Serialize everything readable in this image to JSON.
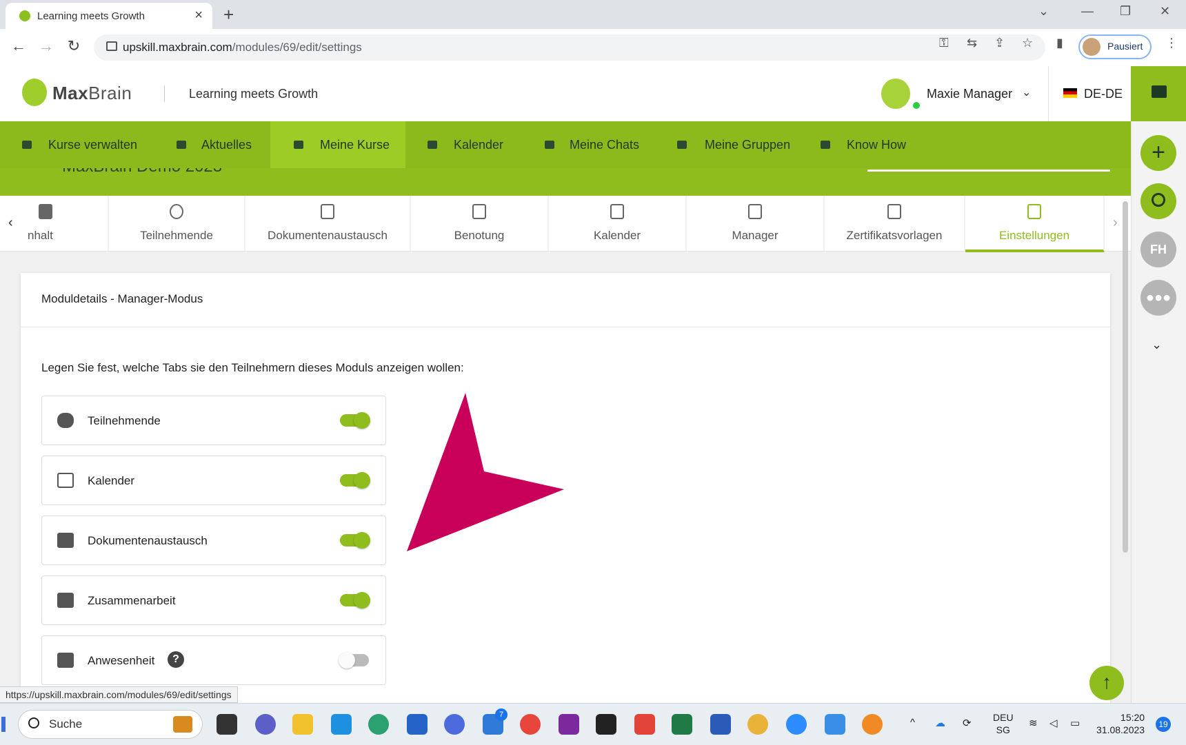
{
  "browser": {
    "tab_title": "Learning meets Growth",
    "new_tab": "+",
    "url_host": "upskill.maxbrain.com",
    "url_path": "/modules/69/edit/settings",
    "profile_status": "Pausiert",
    "status_url": "https://upskill.maxbrain.com/modules/69/edit/settings"
  },
  "header": {
    "logo_bold": "Max",
    "logo_light": "Brain",
    "tagline": "Learning meets Growth",
    "user_name": "Maxie Manager",
    "language": "DE-DE"
  },
  "rail": {
    "add": "+",
    "initials": "FH"
  },
  "nav": {
    "items": [
      {
        "label": "Kurse verwalten"
      },
      {
        "label": "Aktuelles"
      },
      {
        "label": "Meine Kurse"
      },
      {
        "label": "Kalender"
      },
      {
        "label": "Meine Chats"
      },
      {
        "label": "Meine Gruppen"
      },
      {
        "label": "Know How"
      }
    ],
    "active": "Meine Kurse",
    "behind_title": "MaxBrain Demo 2023"
  },
  "module_tabs": {
    "items": [
      {
        "label": "nhalt"
      },
      {
        "label": "Teilnehmende"
      },
      {
        "label": "Dokumentenaustausch"
      },
      {
        "label": "Benotung"
      },
      {
        "label": "Kalender"
      },
      {
        "label": "Manager"
      },
      {
        "label": "Zertifikatsvorlagen"
      },
      {
        "label": "Einstellungen"
      }
    ],
    "active": "Einstellungen"
  },
  "card": {
    "title": "Moduldetails - Manager-Modus",
    "description": "Legen Sie fest, welche Tabs sie den Teilnehmern dieses Moduls anzeigen wollen:",
    "toggles": [
      {
        "label": "Teilnehmende",
        "icon": "people-icon",
        "enabled": true
      },
      {
        "label": "Kalender",
        "icon": "calendar-icon",
        "enabled": true
      },
      {
        "label": "Dokumentenaustausch",
        "icon": "document-exchange-icon",
        "enabled": true
      },
      {
        "label": "Zusammenarbeit",
        "icon": "folder-user-icon",
        "enabled": true
      },
      {
        "label": "Anwesenheit",
        "icon": "folder-user-icon",
        "enabled": false,
        "help": "?"
      }
    ]
  },
  "taskbar": {
    "search": "Suche",
    "edge_badge": "7",
    "lang_line1": "DEU",
    "lang_line2": "SG",
    "time": "15:20",
    "date": "31.08.2023",
    "notifications": "19"
  },
  "colors": {
    "accent": "#8fbd1e",
    "annotation_arrow": "#c8005a"
  }
}
